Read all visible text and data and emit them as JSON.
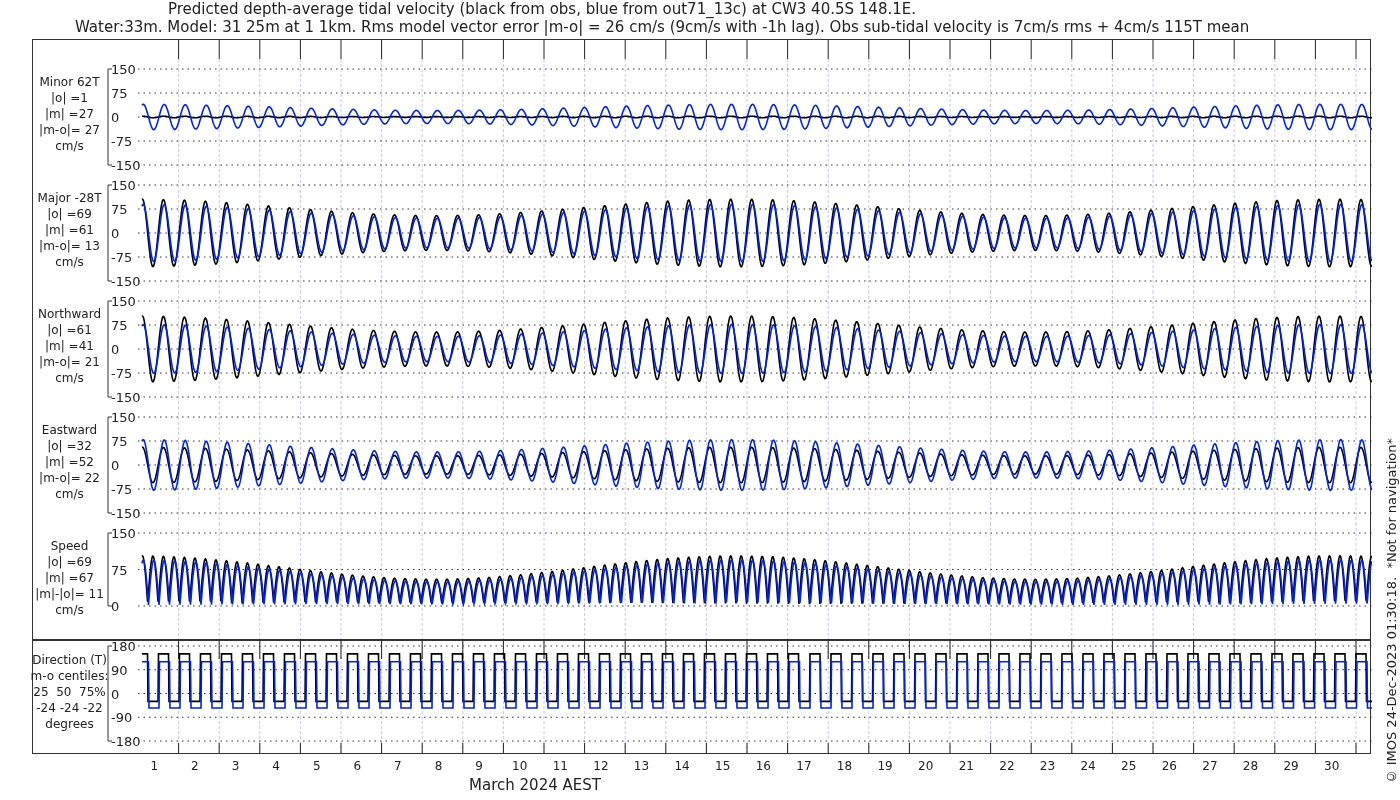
{
  "title": {
    "line_1": "Predicted depth-average tidal velocity (black from obs, blue from out71_13c) at CW3 40.5S 148.1E.",
    "line_2": "Water:33m. Model: 31 25m at 1 1km. Rms model vector error |m-o| = 26 cm/s (9cm/s with -1h lag). Obs sub-tidal velocity is 7cm/s rms + 4cm/s 115T mean"
  },
  "panels": [
    {
      "kind": "signed",
      "labels": [
        "Minor 62T",
        "|o| =1",
        "|m| =27",
        "|m-o|= 27",
        "cm/s"
      ],
      "yticks": [
        "150",
        "75",
        "0",
        "-75",
        "-150"
      ]
    },
    {
      "kind": "signed",
      "labels": [
        "Major -28T",
        "|o| =69",
        "|m| =61",
        "|m-o|= 13",
        "cm/s"
      ],
      "yticks": [
        "150",
        "75",
        "0",
        "-75",
        "-150"
      ]
    },
    {
      "kind": "signed",
      "labels": [
        "Northward",
        "|o| =61",
        "|m| =41",
        "|m-o|= 21",
        "cm/s"
      ],
      "yticks": [
        "150",
        "75",
        "0",
        "-75",
        "-150"
      ]
    },
    {
      "kind": "signed",
      "labels": [
        "Eastward",
        "|o| =32",
        "|m| =52",
        "|m-o|= 22",
        "cm/s"
      ],
      "yticks": [
        "150",
        "75",
        "0",
        "-75",
        "-150"
      ]
    },
    {
      "kind": "speed",
      "labels": [
        "Speed",
        "|o| =69",
        "|m| =67",
        "|m|-|o|= 11",
        "cm/s"
      ],
      "yticks": [
        "150",
        "75",
        "0"
      ]
    },
    {
      "kind": "direction",
      "labels": [
        "Direction (T)",
        "m-o centiles:",
        "25  50  75%",
        "-24 -24 -22",
        "degrees"
      ],
      "yticks": [
        "180",
        "90",
        "0",
        "-90",
        "-180"
      ]
    }
  ],
  "x_axis": {
    "ticks": [
      "1",
      "2",
      "3",
      "4",
      "5",
      "6",
      "7",
      "8",
      "9",
      "10",
      "11",
      "12",
      "13",
      "14",
      "15",
      "16",
      "17",
      "18",
      "19",
      "20",
      "21",
      "22",
      "23",
      "24",
      "25",
      "26",
      "27",
      "28",
      "29",
      "30"
    ],
    "label": "March 2024 AEST"
  },
  "credit": "© IMOS 24-Dec-2023 01:30:18.  *Not for navigation*"
}
